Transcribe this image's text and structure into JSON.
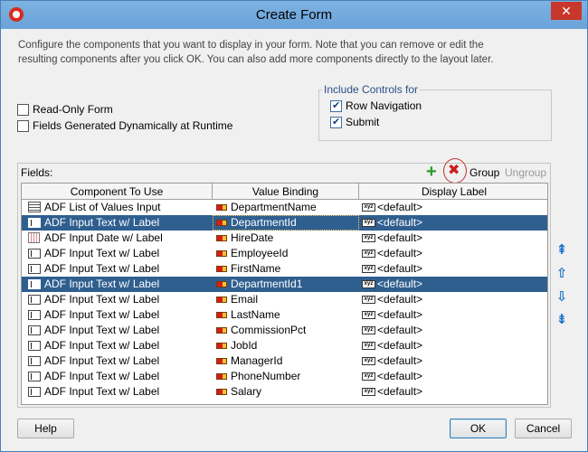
{
  "window": {
    "title": "Create Form",
    "close_symbol": "✕"
  },
  "intro_text": "Configure the components that you want to display in your form. Note that you can remove or edit the resulting components after you click OK. You can also add more components directly to the layout later.",
  "options": {
    "read_only": {
      "label": "Read-Only Form",
      "checked": false
    },
    "dynamic": {
      "label": "Fields Generated Dynamically at Runtime",
      "checked": false
    }
  },
  "include_controls": {
    "legend": "Include Controls for",
    "row_navigation": {
      "label": "Row Navigation",
      "checked": true
    },
    "submit": {
      "label": "Submit",
      "checked": true
    }
  },
  "fields": {
    "label": "Fields:",
    "toolbar": {
      "group": "Group",
      "ungroup": "Ungroup"
    },
    "columns": [
      "Component To Use",
      "Value Binding",
      "Display Label"
    ],
    "rows": [
      {
        "component": "ADF List of Values Input",
        "icon": "lov-icon",
        "binding": "DepartmentName",
        "label": "<default>",
        "selected": false
      },
      {
        "component": "ADF Input Text w/ Label",
        "icon": "input-text-icon",
        "binding": "DepartmentId",
        "label": "<default>",
        "selected": true
      },
      {
        "component": "ADF Input Date w/ Label",
        "icon": "input-date-icon",
        "binding": "HireDate",
        "label": "<default>",
        "selected": false
      },
      {
        "component": "ADF Input Text w/ Label",
        "icon": "input-text-icon",
        "binding": "EmployeeId",
        "label": "<default>",
        "selected": false
      },
      {
        "component": "ADF Input Text w/ Label",
        "icon": "input-text-icon",
        "binding": "FirstName",
        "label": "<default>",
        "selected": false
      },
      {
        "component": "ADF Input Text w/ Label",
        "icon": "input-text-icon",
        "binding": "DepartmentId1",
        "label": "<default>",
        "selected": true
      },
      {
        "component": "ADF Input Text w/ Label",
        "icon": "input-text-icon",
        "binding": "Email",
        "label": "<default>",
        "selected": false
      },
      {
        "component": "ADF Input Text w/ Label",
        "icon": "input-text-icon",
        "binding": "LastName",
        "label": "<default>",
        "selected": false
      },
      {
        "component": "ADF Input Text w/ Label",
        "icon": "input-text-icon",
        "binding": "CommissionPct",
        "label": "<default>",
        "selected": false
      },
      {
        "component": "ADF Input Text w/ Label",
        "icon": "input-text-icon",
        "binding": "JobId",
        "label": "<default>",
        "selected": false
      },
      {
        "component": "ADF Input Text w/ Label",
        "icon": "input-text-icon",
        "binding": "ManagerId",
        "label": "<default>",
        "selected": false
      },
      {
        "component": "ADF Input Text w/ Label",
        "icon": "input-text-icon",
        "binding": "PhoneNumber",
        "label": "<default>",
        "selected": false
      },
      {
        "component": "ADF Input Text w/ Label",
        "icon": "input-text-icon",
        "binding": "Salary",
        "label": "<default>",
        "selected": false
      }
    ]
  },
  "buttons": {
    "help": "Help",
    "ok": "OK",
    "cancel": "Cancel"
  },
  "colors": {
    "selection": "#2f5f8f",
    "titlebar": "#6aa3d8",
    "close": "#c7372b"
  }
}
